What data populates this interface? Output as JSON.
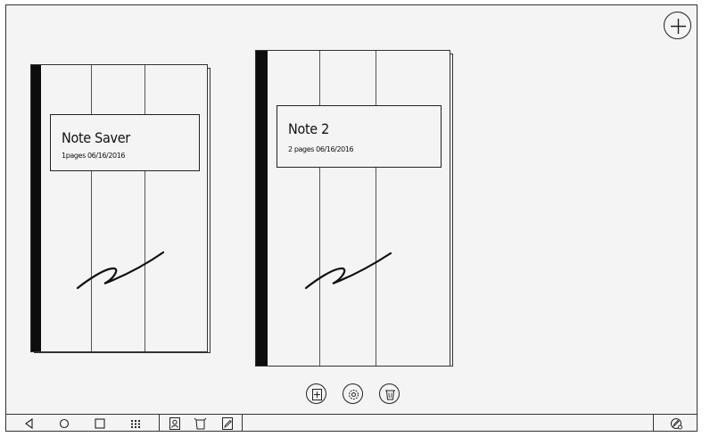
{
  "toolbar": {
    "add_icon": "plus-circle-icon"
  },
  "notebooks": [
    {
      "title": "Note Saver",
      "meta": "1pages 06/16/2016"
    },
    {
      "title": "Note 2",
      "meta": "2 pages 06/16/2016"
    }
  ],
  "actions": [
    {
      "icon": "add-page-icon"
    },
    {
      "icon": "settings-icon"
    },
    {
      "icon": "trash-icon"
    }
  ],
  "bottom_bar": {
    "nav": [
      "back-icon",
      "home-icon",
      "recents-icon",
      "apps-icon"
    ],
    "tools": [
      "contacts-icon",
      "crop-icon",
      "edit-icon"
    ],
    "right": "pen-settings-icon"
  }
}
